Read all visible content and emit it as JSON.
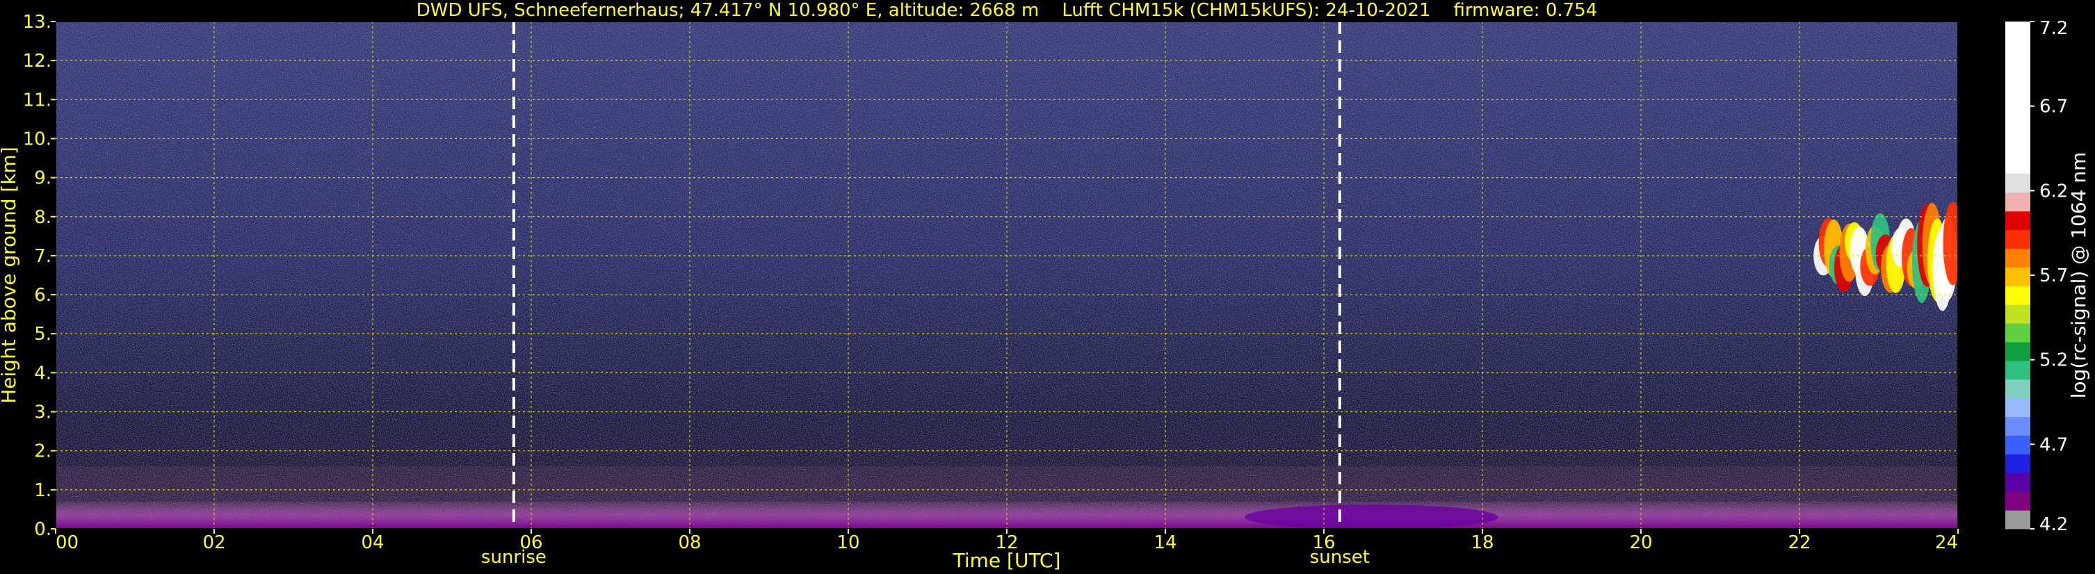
{
  "chart_data": {
    "type": "heatmap",
    "title": "DWD UFS, Schneefernerhaus; 47.417° N 10.980° E, altitude: 2668 m    Lufft CHM15k (CHM15kUFS): 24-10-2021    firmware: 0.754",
    "xlabel": "Time [UTC]",
    "ylabel": "Height above ground [km]",
    "xlim": [
      0,
      24
    ],
    "ylim": [
      0,
      13
    ],
    "x_ticks": [
      "00",
      "02",
      "04",
      "06",
      "08",
      "10",
      "12",
      "14",
      "16",
      "18",
      "20",
      "22",
      "24"
    ],
    "x_tick_values": [
      0,
      2,
      4,
      6,
      8,
      10,
      12,
      14,
      16,
      18,
      20,
      22,
      24
    ],
    "y_ticks": [
      "0.",
      "1.",
      "2.",
      "3.",
      "4.",
      "5.",
      "6.",
      "7.",
      "8.",
      "9.",
      "10.",
      "11.",
      "12.",
      "13."
    ],
    "y_tick_values": [
      0,
      1,
      2,
      3,
      4,
      5,
      6,
      7,
      8,
      9,
      10,
      11,
      12,
      13
    ],
    "grid": true,
    "events": [
      {
        "label": "sunrise",
        "time": 5.78
      },
      {
        "label": "sunset",
        "time": 16.2
      }
    ],
    "cloud_layers": [
      {
        "t_start": 22.3,
        "t_end": 24.0,
        "h_bottom": 5.7,
        "h_top": 7.6
      }
    ],
    "colorbar": {
      "label": "log(rc-signal) @ 1064 nm",
      "range": [
        4.2,
        7.2
      ],
      "ticks": [
        "4.2",
        "4.7",
        "5.2",
        "5.7",
        "6.2",
        "6.7",
        "7.2"
      ],
      "tick_values": [
        4.2,
        4.7,
        5.2,
        5.7,
        6.2,
        6.7,
        7.2
      ],
      "colors": [
        "#9a9a9a",
        "#80007f",
        "#5a00a8",
        "#2020e0",
        "#3a60ff",
        "#6a8cff",
        "#9ab8ff",
        "#7fd0c0",
        "#30c080",
        "#10a040",
        "#60d040",
        "#c0e020",
        "#ffff00",
        "#ffc000",
        "#ff8000",
        "#ff3000",
        "#e00000",
        "#f0b0b0",
        "#e0e0e0",
        "#ffffff"
      ]
    }
  }
}
